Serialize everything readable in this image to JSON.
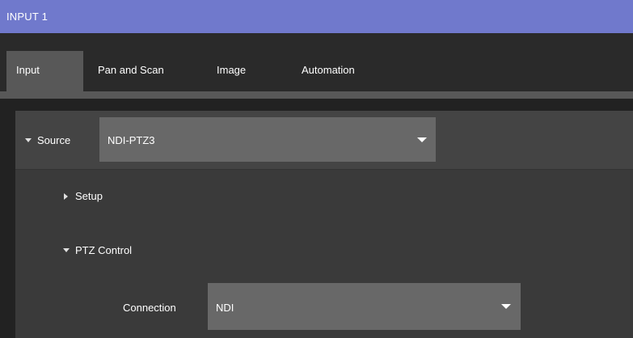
{
  "window": {
    "title": "INPUT 1",
    "accent_color": "#7079cc"
  },
  "tabs": [
    {
      "label": "Input",
      "active": true
    },
    {
      "label": "Pan and Scan",
      "active": false
    },
    {
      "label": "Image",
      "active": false
    },
    {
      "label": "Automation",
      "active": false
    }
  ],
  "source": {
    "label": "Source",
    "expanded": true,
    "selected": "NDI-PTZ3"
  },
  "setup": {
    "label": "Setup",
    "expanded": false
  },
  "ptz": {
    "label": "PTZ Control",
    "expanded": true,
    "connection_label": "Connection",
    "connection_value": "NDI"
  },
  "icons": {
    "expanded": "triangle-down",
    "collapsed": "triangle-right",
    "dropdown": "chevron-down"
  }
}
